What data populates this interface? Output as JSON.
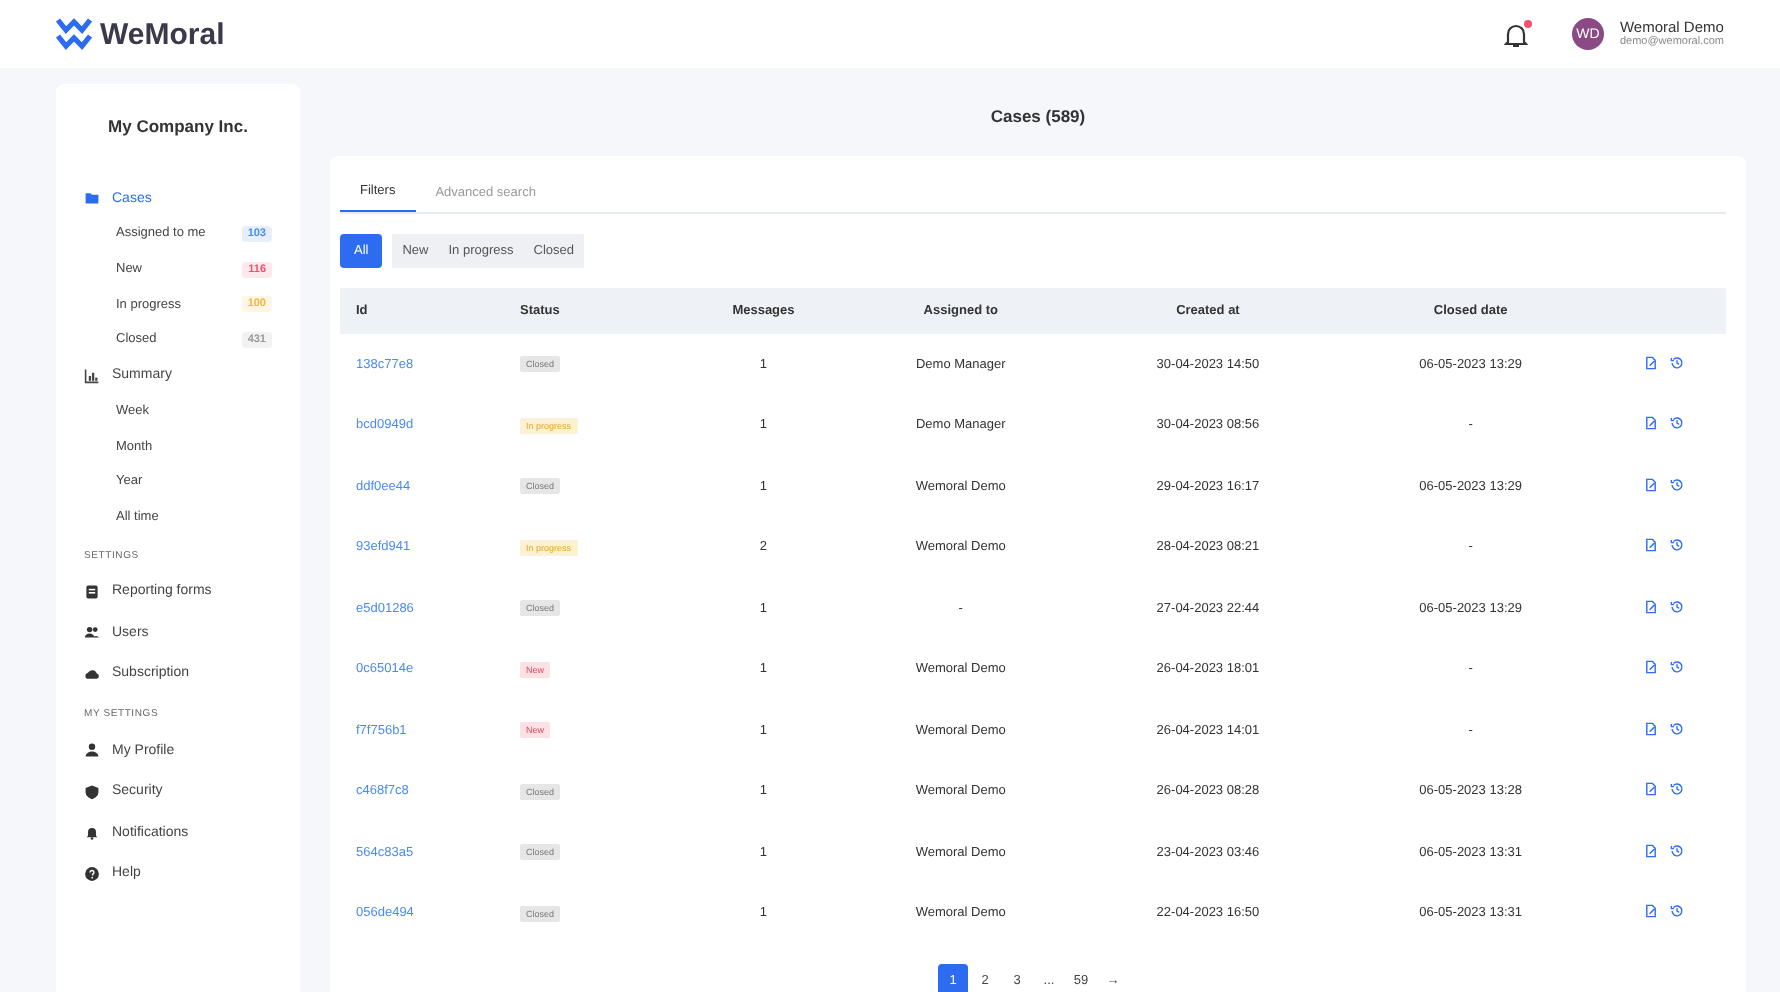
{
  "header": {
    "logo": "WeMoral",
    "notification_dot": true,
    "user": {
      "initials": "WD",
      "name": "Wemoral Demo",
      "email": "demo@wemoral.com"
    }
  },
  "sidebar": {
    "company": "My Company Inc.",
    "nav": [
      {
        "label": "Cases",
        "selected": true,
        "children": [
          {
            "label": "Assigned to me",
            "count": "103",
            "color": "#4a8af4"
          },
          {
            "label": "New",
            "count": "116",
            "color": "#f0506e"
          },
          {
            "label": "In progress",
            "count": "100",
            "color": "#f5b638"
          },
          {
            "label": "Closed",
            "count": "431",
            "color": "#9a9a9a"
          }
        ]
      },
      {
        "label": "Summary",
        "selected": false,
        "children": [
          {
            "label": "Week"
          },
          {
            "label": "Month"
          },
          {
            "label": "Year"
          },
          {
            "label": "All time"
          }
        ]
      }
    ],
    "groups": [
      {
        "heading": "SETTINGS",
        "items": [
          {
            "label": "Reporting forms"
          },
          {
            "label": "Users"
          },
          {
            "label": "Subscription"
          }
        ]
      },
      {
        "heading": "MY SETTINGS",
        "items": [
          {
            "label": "My Profile"
          },
          {
            "label": "Security"
          },
          {
            "label": "Notifications"
          },
          {
            "label": "Help"
          }
        ]
      }
    ]
  },
  "main": {
    "title": "Cases (589)",
    "tabs": [
      {
        "label": "Filters",
        "selected": true
      },
      {
        "label": "Advanced search",
        "selected": false
      }
    ],
    "filters": [
      {
        "label": "All",
        "selected": true
      },
      {
        "label": "New",
        "selected": false
      },
      {
        "label": "In progress",
        "selected": false
      },
      {
        "label": "Closed",
        "selected": false
      }
    ],
    "table": {
      "columns": [
        "Id",
        "Status",
        "Messages",
        "Assigned to",
        "Created at",
        "Closed date"
      ],
      "rows": [
        {
          "id": "138c77e8",
          "status": "Closed",
          "kind": "closed",
          "messages": "1",
          "assigned": "Demo Manager",
          "created": "30-04-2023 14:50",
          "closed": "06-05-2023 13:29"
        },
        {
          "id": "bcd0949d",
          "status": "In progress",
          "kind": "in_progress",
          "messages": "1",
          "assigned": "Demo Manager",
          "created": "30-04-2023 08:56",
          "closed": "-"
        },
        {
          "id": "ddf0ee44",
          "status": "Closed",
          "kind": "closed",
          "messages": "1",
          "assigned": "Wemoral Demo",
          "created": "29-04-2023 16:17",
          "closed": "06-05-2023 13:29"
        },
        {
          "id": "93efd941",
          "status": "In progress",
          "kind": "in_progress",
          "messages": "2",
          "assigned": "Wemoral Demo",
          "created": "28-04-2023 08:21",
          "closed": "-"
        },
        {
          "id": "e5d01286",
          "status": "Closed",
          "kind": "closed",
          "messages": "1",
          "assigned": "-",
          "created": "27-04-2023 22:44",
          "closed": "06-05-2023 13:29"
        },
        {
          "id": "0c65014e",
          "status": "New",
          "kind": "new",
          "messages": "1",
          "assigned": "Wemoral Demo",
          "created": "26-04-2023 18:01",
          "closed": "-"
        },
        {
          "id": "f7f756b1",
          "status": "New",
          "kind": "new",
          "messages": "1",
          "assigned": "Wemoral Demo",
          "created": "26-04-2023 14:01",
          "closed": "-"
        },
        {
          "id": "c468f7c8",
          "status": "Closed",
          "kind": "closed",
          "messages": "1",
          "assigned": "Wemoral Demo",
          "created": "26-04-2023 08:28",
          "closed": "06-05-2023 13:28"
        },
        {
          "id": "564c83a5",
          "status": "Closed",
          "kind": "closed",
          "messages": "1",
          "assigned": "Wemoral Demo",
          "created": "23-04-2023 03:46",
          "closed": "06-05-2023 13:31"
        },
        {
          "id": "056de494",
          "status": "Closed",
          "kind": "closed",
          "messages": "1",
          "assigned": "Wemoral Demo",
          "created": "22-04-2023 16:50",
          "closed": "06-05-2023 13:31"
        }
      ]
    },
    "pagination": [
      {
        "label": "1",
        "selected": true
      },
      {
        "label": "2",
        "selected": false
      },
      {
        "label": "3",
        "selected": false
      },
      {
        "label": "...",
        "selected": false
      },
      {
        "label": "59",
        "selected": false
      },
      {
        "label": "→",
        "selected": false
      }
    ]
  }
}
